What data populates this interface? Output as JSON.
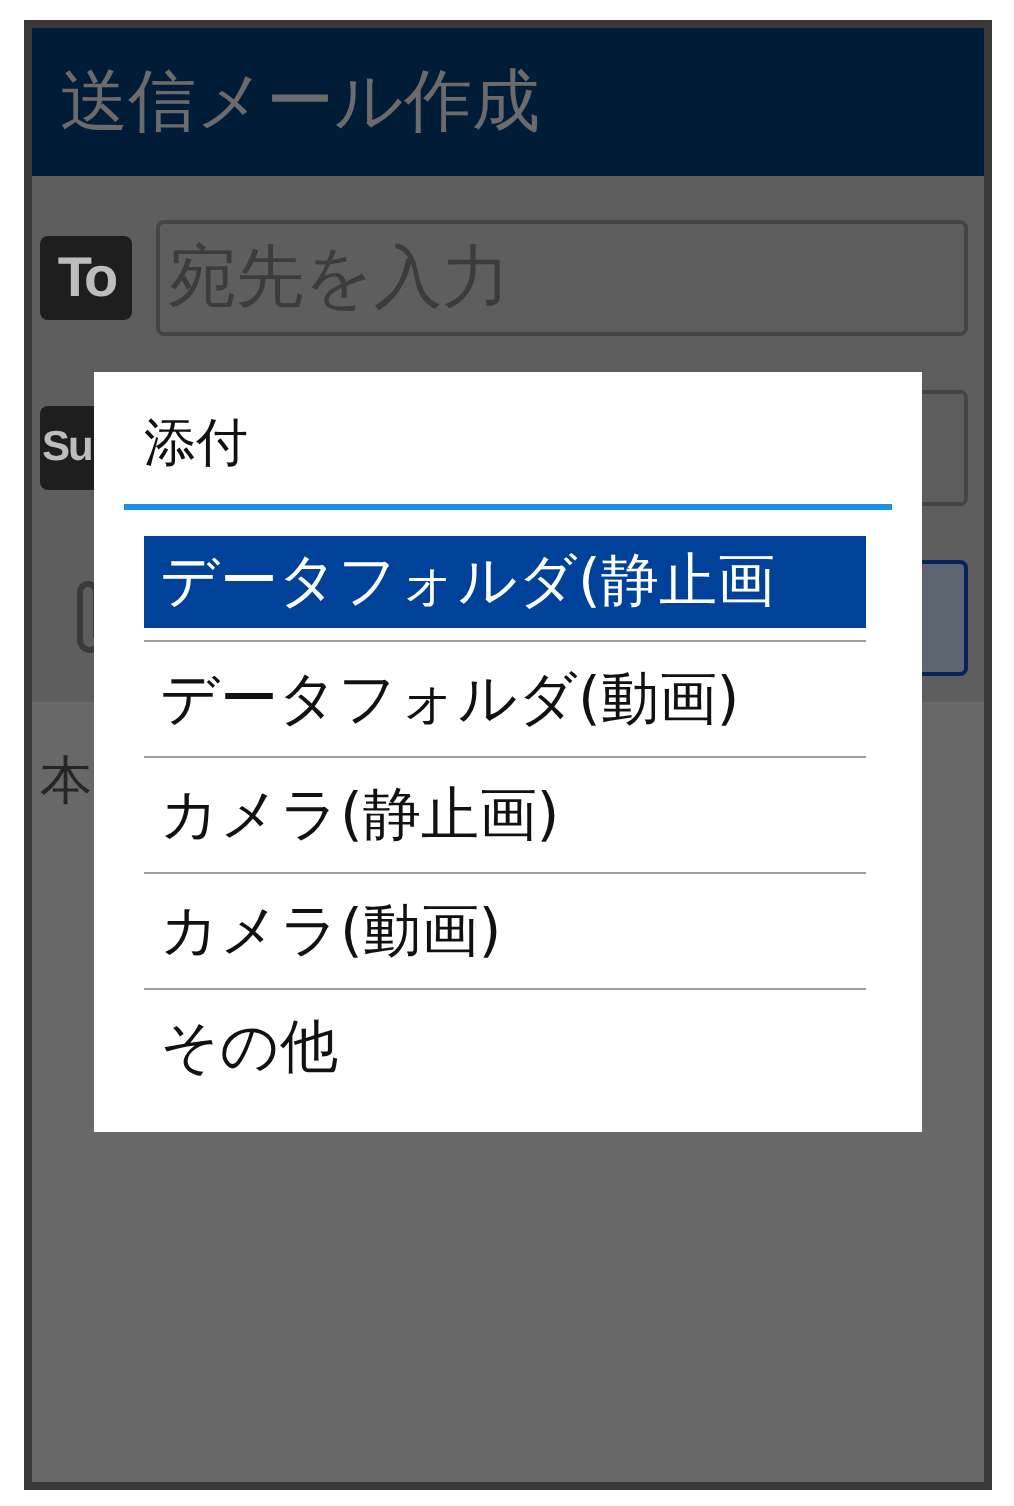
{
  "header": {
    "title": "送信メール作成"
  },
  "fields": [
    {
      "kind": "to",
      "badge": "To",
      "placeholder": "宛先を入力",
      "focused": false
    },
    {
      "kind": "subject",
      "badge": "Su",
      "focused": false
    },
    {
      "kind": "attachment",
      "focused": true
    }
  ],
  "body": {
    "label": "本"
  },
  "dialog": {
    "title": "添付",
    "items": [
      {
        "label": "データフォルダ(静止画",
        "selected": true
      },
      {
        "label": "データフォルダ(動画)",
        "selected": false
      },
      {
        "label": "カメラ(静止画)",
        "selected": false
      },
      {
        "label": "カメラ(動画)",
        "selected": false
      },
      {
        "label": "その他",
        "selected": false
      }
    ]
  }
}
